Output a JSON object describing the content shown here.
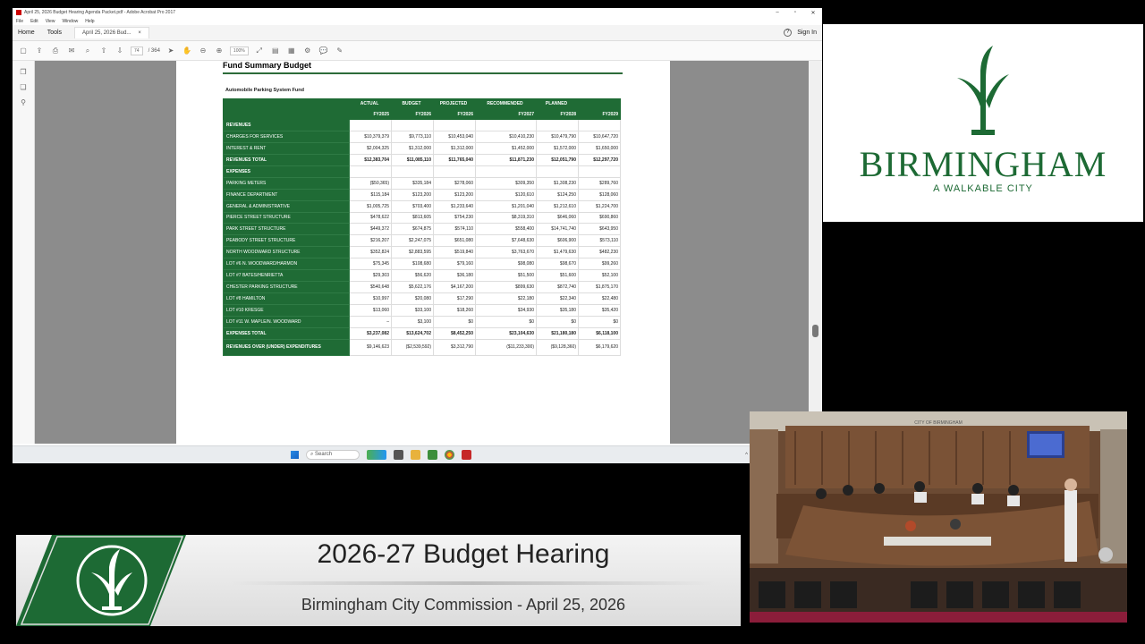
{
  "window": {
    "title": "April 25, 2026 Budget Hearing Agenda Packet.pdf - Adobe Acrobat Pro 2017",
    "menu": [
      "File",
      "Edit",
      "View",
      "Window",
      "Help"
    ],
    "controls": {
      "minimize": "–",
      "maximize": "▫",
      "close": "✕"
    }
  },
  "tabs": {
    "home": "Home",
    "tools": "Tools",
    "document": "April 25, 2026 Bud...",
    "close_glyph": "×",
    "sign_in": "Sign In",
    "help_glyph": "?"
  },
  "toolbar": {
    "page_current": "74",
    "page_total": "/ 364",
    "zoom": "100%"
  },
  "document": {
    "page_title": "Fund Summary Budget",
    "fund_name": "Automobile Parking System Fund",
    "column_headers": [
      "ACTUAL",
      "BUDGET",
      "PROJECTED",
      "RECOMMENDED",
      "PLANNED",
      ""
    ],
    "column_years": [
      "FY2025",
      "FY2026",
      "FY2026",
      "FY2027",
      "FY2028",
      "FY2029"
    ],
    "rows": [
      {
        "label": "REVENUES",
        "values": [
          "",
          "",
          "",
          "",
          "",
          ""
        ],
        "style": "sect"
      },
      {
        "label": "CHARGES FOR SERVICES",
        "values": [
          "$10,379,379",
          "$9,773,110",
          "$10,453,040",
          "$10,410,230",
          "$10,479,790",
          "$10,647,720"
        ],
        "style": ""
      },
      {
        "label": "INTEREST & RENT",
        "values": [
          "$2,004,325",
          "$1,312,000",
          "$1,312,000",
          "$1,452,000",
          "$1,572,000",
          "$1,650,000"
        ],
        "style": ""
      },
      {
        "label": "REVENUES TOTAL",
        "values": [
          "$12,383,704",
          "$11,085,110",
          "$11,765,040",
          "$11,871,230",
          "$12,051,790",
          "$12,297,720"
        ],
        "style": "bold"
      },
      {
        "label": "EXPENSES",
        "values": [
          "",
          "",
          "",
          "",
          "",
          ""
        ],
        "style": "sect"
      },
      {
        "label": "PARKING METERS",
        "values": [
          "($50,365)",
          "$335,184",
          "$278,060",
          "$309,350",
          "$1,308,230",
          "$289,760"
        ],
        "style": ""
      },
      {
        "label": "FINANCE DEPARTMENT",
        "values": [
          "$115,184",
          "$123,200",
          "$123,200",
          "$120,610",
          "$124,250",
          "$128,060"
        ],
        "style": ""
      },
      {
        "label": "GENERAL & ADMINISTRATIVE",
        "values": [
          "$1,005,725",
          "$703,400",
          "$1,233,640",
          "$1,201,040",
          "$1,212,610",
          "$1,224,700"
        ],
        "style": ""
      },
      {
        "label": "PIERCE STREET STRUCTURE",
        "values": [
          "$478,622",
          "$813,605",
          "$754,230",
          "$8,319,310",
          "$646,060",
          "$690,860"
        ],
        "style": ""
      },
      {
        "label": "PARK STREET STRUCTURE",
        "values": [
          "$449,372",
          "$674,875",
          "$574,110",
          "$558,400",
          "$14,741,740",
          "$643,950"
        ],
        "style": ""
      },
      {
        "label": "PEABODY STREET STRUCTURE",
        "values": [
          "$216,207",
          "$2,247,075",
          "$651,080",
          "$7,648,630",
          "$606,900",
          "$573,110"
        ],
        "style": ""
      },
      {
        "label": "NORTH WOODWARD STRUCTURE",
        "values": [
          "$352,824",
          "$2,883,595",
          "$519,840",
          "$3,763,670",
          "$1,479,630",
          "$482,230"
        ],
        "style": ""
      },
      {
        "label": "LOT #6 N. WOODWARD/HARMON",
        "values": [
          "$75,345",
          "$108,680",
          "$79,160",
          "$98,080",
          "$98,670",
          "$99,260"
        ],
        "style": ""
      },
      {
        "label": "LOT #7 BATES/HENRIETTA",
        "values": [
          "$29,303",
          "$56,620",
          "$36,180",
          "$51,500",
          "$51,600",
          "$52,100"
        ],
        "style": ""
      },
      {
        "label": "CHESTER PARKING STRUCTURE",
        "values": [
          "$540,648",
          "$5,622,176",
          "$4,167,200",
          "$899,630",
          "$872,740",
          "$1,875,170"
        ],
        "style": ""
      },
      {
        "label": "LOT #8 HAMILTON",
        "values": [
          "$10,997",
          "$20,080",
          "$17,290",
          "$22,180",
          "$22,340",
          "$22,480"
        ],
        "style": ""
      },
      {
        "label": "LOT #10 KRESGE",
        "values": [
          "$13,060",
          "$33,100",
          "$18,260",
          "$34,930",
          "$35,180",
          "$35,420"
        ],
        "style": ""
      },
      {
        "label": "LOT #11 W. MAPLE/N. WOODWARD",
        "values": [
          "–",
          "$3,100",
          "$0",
          "$0",
          "$0",
          "$0"
        ],
        "style": ""
      },
      {
        "label": "EXPENSES TOTAL",
        "values": [
          "$3,237,082",
          "$13,624,702",
          "$8,452,250",
          "$23,104,630",
          "$21,180,180",
          "$6,118,100"
        ],
        "style": "bold"
      },
      {
        "label": "REVENUES OVER (UNDER) EXPENDITURES",
        "values": [
          "$9,146,623",
          "($2,539,592)",
          "$3,312,790",
          "($11,233,300)",
          "($9,128,360)",
          "$6,179,620"
        ],
        "style": "last"
      }
    ]
  },
  "taskbar": {
    "search_label": "Search",
    "overflow_glyph": "^"
  },
  "logo": {
    "city": "BIRMINGHAM",
    "tagline": "A WALKABLE CITY",
    "brand_green": "#1d6a34"
  },
  "camera": {
    "wall_sign": "CITY OF BIRMINGHAM"
  },
  "lower_third": {
    "title": "2026-27 Budget Hearing",
    "subtitle": "Birmingham City Commission - April 25, 2026"
  }
}
